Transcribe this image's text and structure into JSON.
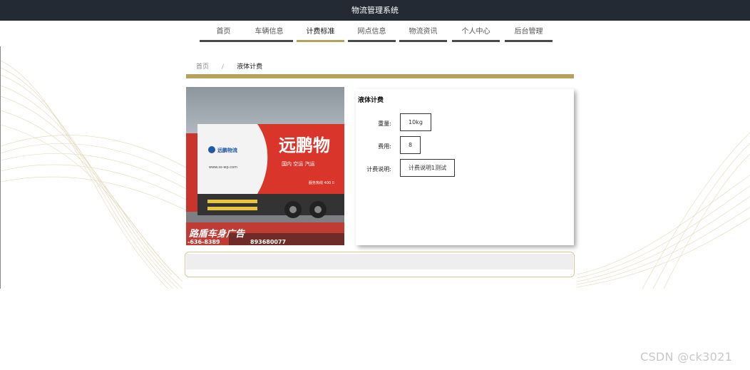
{
  "header": {
    "title": "物流管理系统"
  },
  "nav": {
    "items": [
      {
        "label": "首页",
        "active": false
      },
      {
        "label": "车辆信息",
        "active": false
      },
      {
        "label": "计费标准",
        "active": true
      },
      {
        "label": "网点信息",
        "active": false
      },
      {
        "label": "物流资讯",
        "active": false
      },
      {
        "label": "个人中心",
        "active": false
      },
      {
        "label": "后台管理",
        "active": false
      }
    ]
  },
  "breadcrumb": {
    "home": "首页",
    "separator": "/",
    "current": "液体计费"
  },
  "photo": {
    "brand_text": "远鹏物",
    "logo_text": "远鹏物流",
    "website": "www.ss-wp.com",
    "services": "国内  空运  汽运",
    "hotline": "服务热线  400 0",
    "ad_banner": "路盾车身广告",
    "phone_left": "-636-8389",
    "phone_right": "893680077"
  },
  "detail": {
    "title": "液体计费",
    "fields": [
      {
        "label": "重量:",
        "value": "10kg"
      },
      {
        "label": "费用:",
        "value": "8"
      },
      {
        "label": "计费说明:",
        "value": "计费说明1测试"
      }
    ]
  },
  "watermark": "CSDN @ck3021",
  "colors": {
    "topbar": "#232a33",
    "accent_gold": "#b8a15d",
    "nav_bar": "#4a4a4a"
  }
}
